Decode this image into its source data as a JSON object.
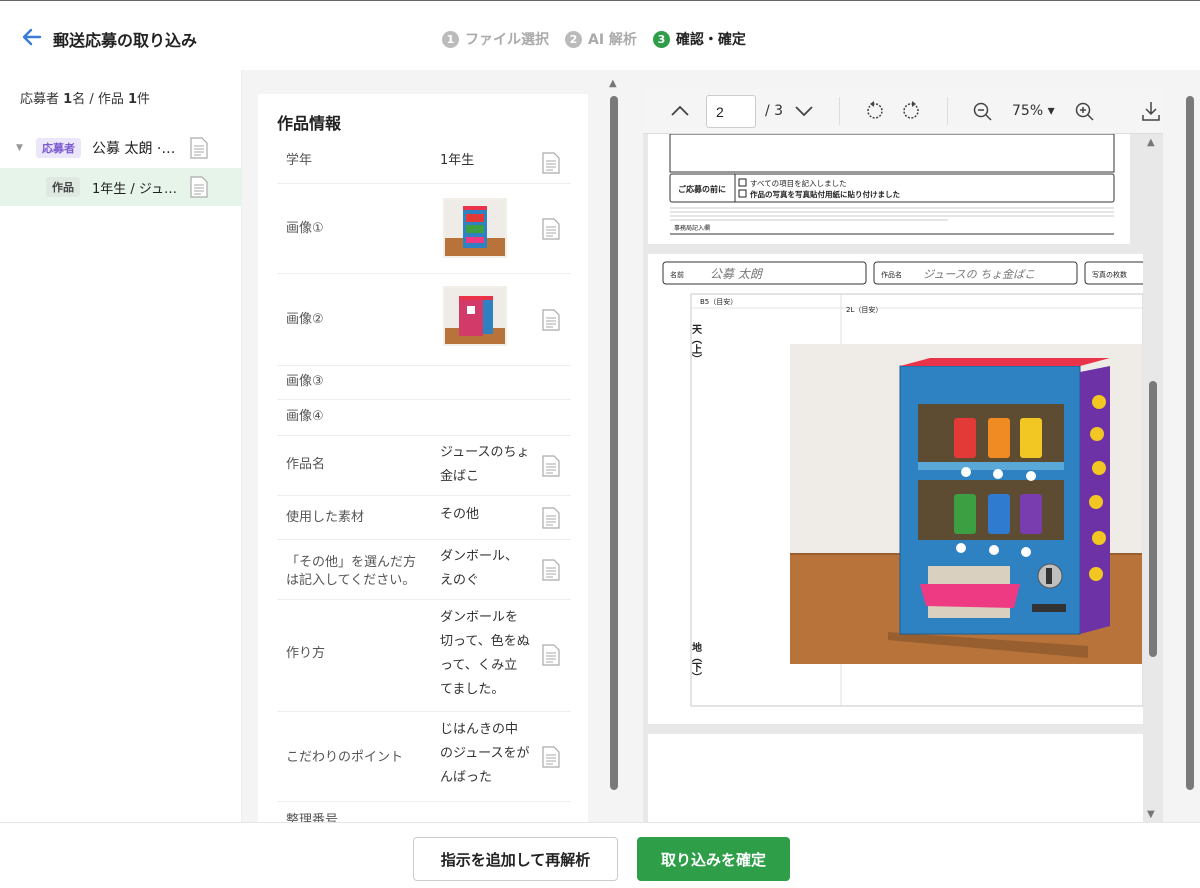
{
  "header": {
    "title": "郵送応募の取り込み",
    "steps": [
      {
        "num": "1",
        "label": "ファイル選択"
      },
      {
        "num": "2",
        "label": "AI 解析"
      },
      {
        "num": "3",
        "label": "確認・確定"
      }
    ],
    "active_step": 3
  },
  "sidebar": {
    "summary_a": "応募者 ",
    "summary_a_count": "1",
    "summary_b": "名 / 作品 ",
    "summary_b_count": "1",
    "summary_c": "件",
    "applicant": {
      "tag": "応募者",
      "name": "公募 太朗 · ···"
    },
    "work": {
      "tag": "作品",
      "label": "1年生 / ジュ…"
    }
  },
  "work_info": {
    "title": "作品情報",
    "fields": [
      {
        "label": "学年",
        "value": "1年生"
      },
      {
        "label": "画像①",
        "value": ""
      },
      {
        "label": "画像②",
        "value": ""
      },
      {
        "label": "画像③",
        "value": ""
      },
      {
        "label": "画像④",
        "value": ""
      },
      {
        "label": "作品名",
        "value": "ジュースのちょ金ばこ"
      },
      {
        "label": "使用した素材",
        "value": "その他"
      },
      {
        "label": "「その他」を選んだ方は記入してください。",
        "value": "ダンボール、えのぐ"
      },
      {
        "label": "作り方",
        "value": "ダンボールを切って、色をぬって、くみ立てました。"
      },
      {
        "label": "こだわりのポイント",
        "value": "じはんきの中のジュースをがんばった"
      },
      {
        "label": "整理番号",
        "value": ""
      }
    ]
  },
  "viewer": {
    "page": "2",
    "total": "/ 3",
    "zoom": "75%",
    "form_top": {
      "check1": "すべての項目を記入しました",
      "check2": "作品の写真を写真貼付用紙に貼り付けました",
      "section_label": "ご応募の前に",
      "office_label": "事務局記入欄"
    },
    "form_main": {
      "name_label": "名前",
      "name_value": "公募 太朗",
      "work_label": "作品名",
      "work_value": "ジュースの ちょ金ばこ",
      "photo_count_label": "写真の枚数",
      "b5": "B5（目安）",
      "l2": "2L（目安）",
      "top_mark": "天（上）",
      "bottom_mark": "地（下）"
    }
  },
  "footer": {
    "reanalyze": "指示を追加して再解析",
    "confirm": "取り込みを確定"
  },
  "colors": {
    "accent": "#2e9e49",
    "link": "#3a7bd5",
    "purple_tag": "#7b5ad0"
  }
}
